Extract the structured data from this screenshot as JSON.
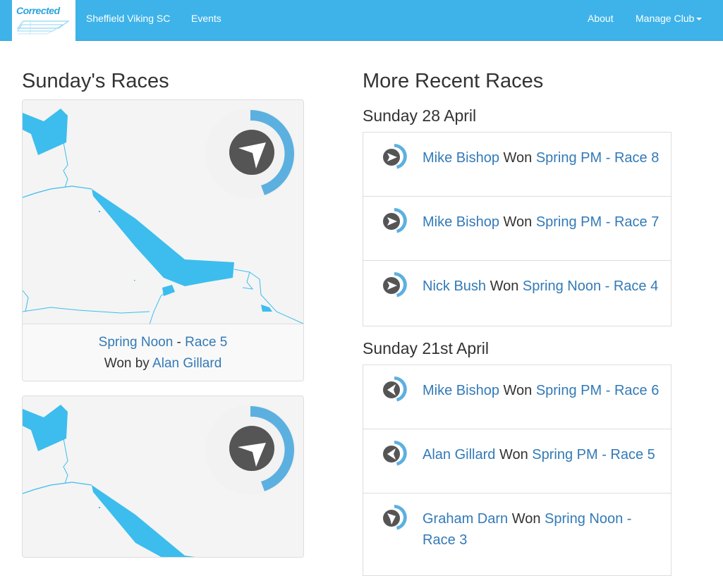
{
  "nav": {
    "brand": "Corrected",
    "club": "Sheffield Viking SC",
    "events": "Events",
    "about": "About",
    "manage": "Manage Club"
  },
  "left": {
    "title": "Sunday's Races",
    "cards": [
      {
        "series": "Spring Noon",
        "sep": " - ",
        "race": "Race 5",
        "won_by": "Won by",
        "winner": "Alan Gillard"
      }
    ]
  },
  "right": {
    "title": "More Recent Races",
    "groups": [
      {
        "date": "Sunday 28 April",
        "items": [
          {
            "winner": "Mike Bishop",
            "won": " Won ",
            "race": "Spring PM - Race 8"
          },
          {
            "winner": "Mike Bishop",
            "won": " Won ",
            "race": "Spring PM - Race 7"
          },
          {
            "winner": "Nick Bush",
            "won": " Won ",
            "race": "Spring Noon - Race 4"
          }
        ]
      },
      {
        "date": "Sunday 21st April",
        "items": [
          {
            "winner": "Mike Bishop",
            "won": " Won ",
            "race": "Spring PM - Race 6"
          },
          {
            "winner": "Alan Gillard",
            "won": " Won ",
            "race": "Spring PM - Race 5"
          },
          {
            "winner": "Graham Darn",
            "won": " Won ",
            "race": "Spring Noon - Race 3"
          }
        ]
      }
    ]
  },
  "colors": {
    "nav": "#3db3e9",
    "link": "#337ab7",
    "water": "#3cbdee",
    "dial": "#5cb0e0",
    "arrow_bg": "#555555"
  }
}
